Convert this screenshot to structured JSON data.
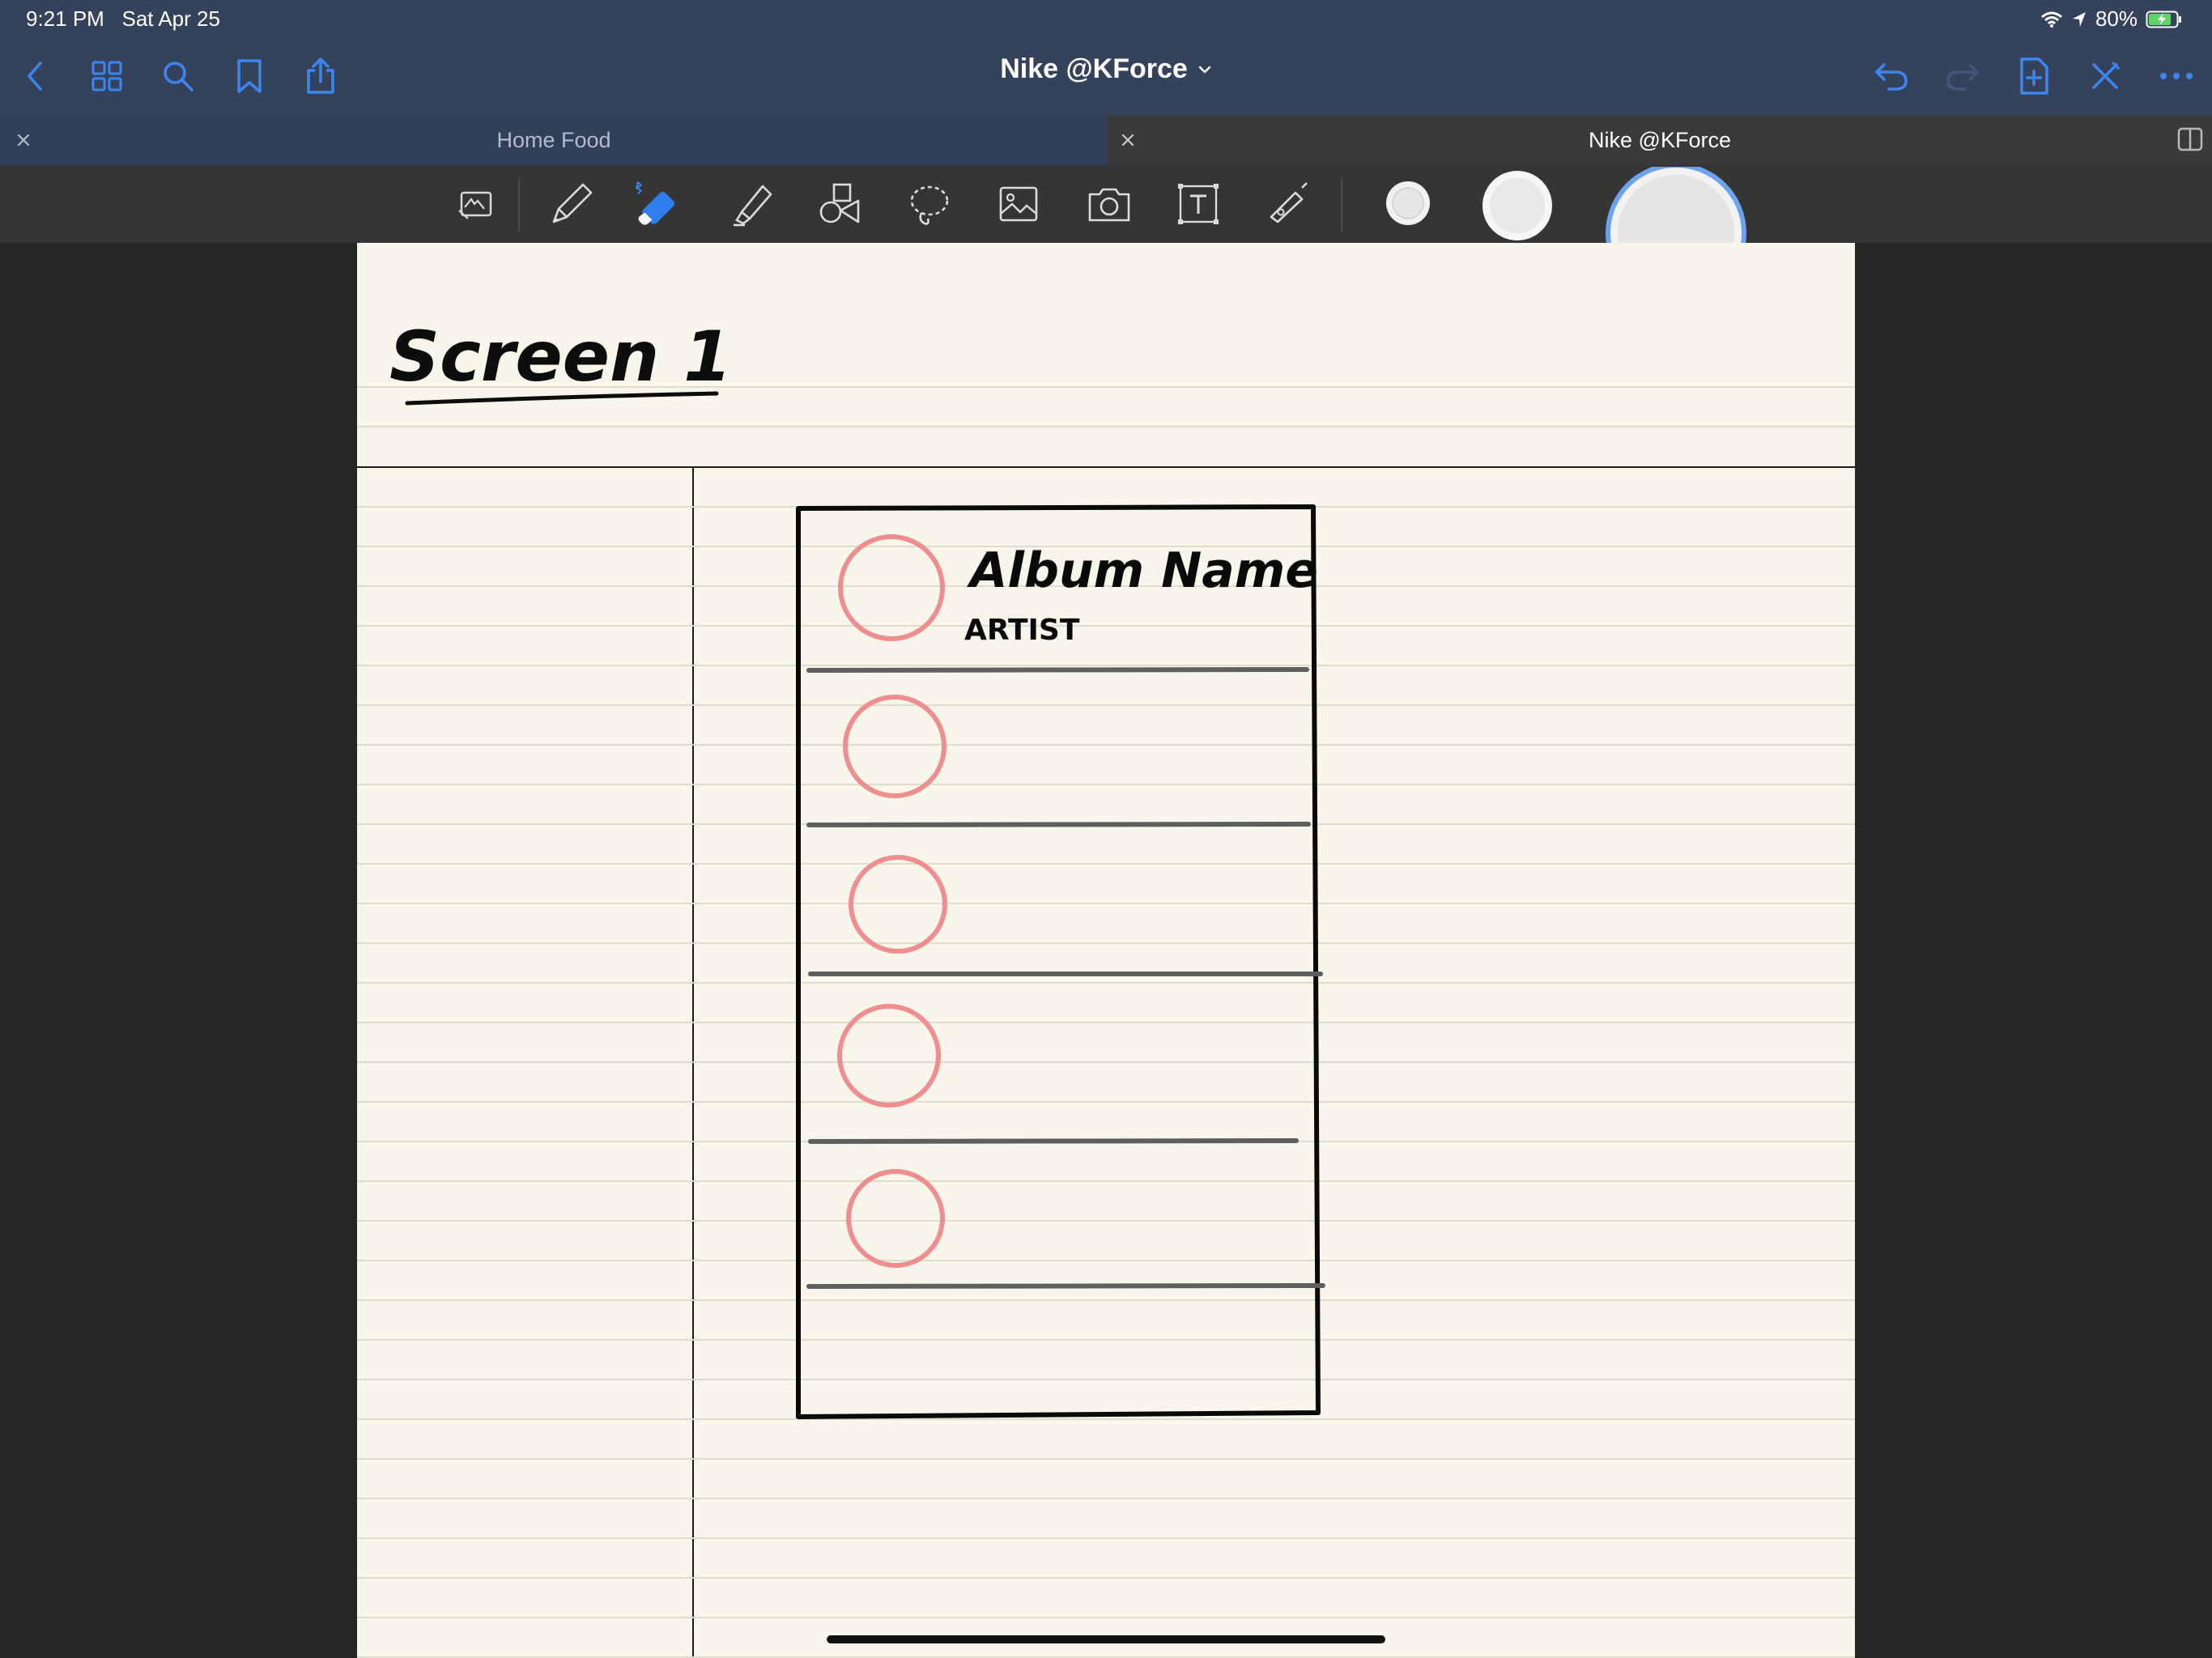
{
  "status": {
    "time": "9:21 PM",
    "date": "Sat Apr 25",
    "battery": "80%"
  },
  "nav": {
    "title": "Nike @KForce",
    "left_icons": [
      "back-chevron-icon",
      "grid-icon",
      "search-icon",
      "bookmark-icon",
      "share-icon"
    ],
    "right_icons": [
      "undo-icon",
      "redo-icon",
      "add-page-icon",
      "close-x-icon",
      "more-icon"
    ]
  },
  "tabs": [
    {
      "label": "Home Food",
      "active": false
    },
    {
      "label": "Nike @KForce",
      "active": true
    }
  ],
  "toolbar": {
    "tools": [
      "read-only-mode-icon",
      "pen-icon",
      "eraser-icon",
      "highlighter-icon",
      "shapes-icon",
      "lasso-icon",
      "image-icon",
      "camera-icon",
      "text-icon",
      "laser-pointer-icon"
    ],
    "selected_tool": "eraser-icon",
    "sizes": [
      "size-small",
      "size-medium",
      "size-large"
    ],
    "selected_size": "size-large"
  },
  "colors": {
    "nav_bg": "#35425c",
    "accent": "#3d86f0",
    "paper": "#f8f6ea",
    "ink": "#000000",
    "circle_ink": "#ee8e8e"
  },
  "note": {
    "title": "Screen 1",
    "row1_title": "Album Name",
    "row1_subtitle": "ARTIST",
    "row_count": 5
  }
}
